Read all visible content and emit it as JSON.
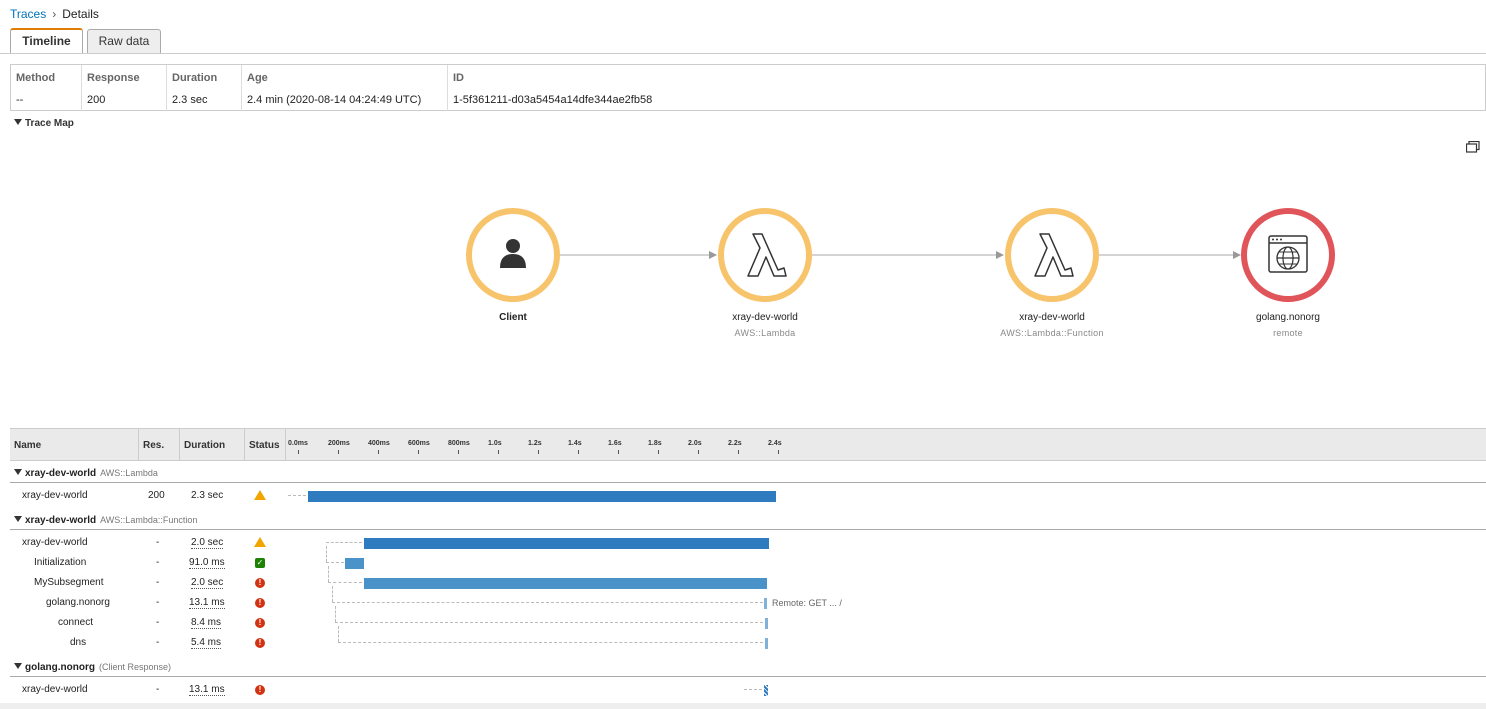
{
  "breadcrumb": {
    "root": "Traces",
    "current": "Details"
  },
  "tabs": [
    {
      "label": "Timeline",
      "active": true
    },
    {
      "label": "Raw data",
      "active": false
    }
  ],
  "summary": {
    "headers": [
      "Method",
      "Response",
      "Duration",
      "Age",
      "ID"
    ],
    "values": [
      "--",
      "200",
      "2.3 sec",
      "2.4 min (2020-08-14 04:24:49 UTC)",
      "1-5f361211-d03a5454a14dfe344ae2fb58"
    ]
  },
  "trace_map": {
    "title": "Trace Map",
    "nodes": [
      {
        "name": "Client",
        "type": "",
        "icon": "user-icon",
        "color": "#f7c46c"
      },
      {
        "name": "xray-dev-world",
        "type": "AWS::Lambda",
        "icon": "lambda-icon",
        "color": "#f7c46c"
      },
      {
        "name": "xray-dev-world",
        "type": "AWS::Lambda::Function",
        "icon": "lambda-icon",
        "color": "#f7c46c"
      },
      {
        "name": "golang.nonorg",
        "type": "remote",
        "icon": "globe-window-icon",
        "color": "#e0555a"
      }
    ]
  },
  "timeline": {
    "columns": [
      "Name",
      "Res.",
      "Duration",
      "Status"
    ],
    "ticks": [
      "0.0ms",
      "200ms",
      "400ms",
      "600ms",
      "800ms",
      "1.0s",
      "1.2s",
      "1.4s",
      "1.6s",
      "1.8s",
      "2.0s",
      "2.2s",
      "2.4s"
    ],
    "groups": [
      {
        "name": "xray-dev-world",
        "type": "AWS::Lambda",
        "rows": [
          {
            "name": "xray-dev-world",
            "res": "200",
            "duration": "2.3 sec",
            "status": "warning"
          }
        ]
      },
      {
        "name": "xray-dev-world",
        "type": "AWS::Lambda::Function",
        "rows": [
          {
            "name": "xray-dev-world",
            "res": "-",
            "duration": "2.0 sec",
            "status": "warning"
          },
          {
            "name": "Initialization",
            "res": "-",
            "duration": "91.0 ms",
            "status": "ok"
          },
          {
            "name": "MySubsegment",
            "res": "-",
            "duration": "2.0 sec",
            "status": "error"
          },
          {
            "name": "golang.nonorg",
            "res": "-",
            "duration": "13.1 ms",
            "status": "error",
            "note": "Remote: GET ... /"
          },
          {
            "name": "connect",
            "res": "-",
            "duration": "8.4 ms",
            "status": "error"
          },
          {
            "name": "dns",
            "res": "-",
            "duration": "5.4 ms",
            "status": "error"
          }
        ]
      },
      {
        "name": "golang.nonorg",
        "type": "(Client Response)",
        "rows": [
          {
            "name": "xray-dev-world",
            "res": "-",
            "duration": "13.1 ms",
            "status": "error"
          }
        ]
      }
    ]
  },
  "colors": {
    "accent_tab": "#e07b00",
    "link": "#0073bb",
    "bar": "#2e7bbf",
    "warning": "#f0a500",
    "error": "#d13212",
    "ok": "#1d8102"
  }
}
